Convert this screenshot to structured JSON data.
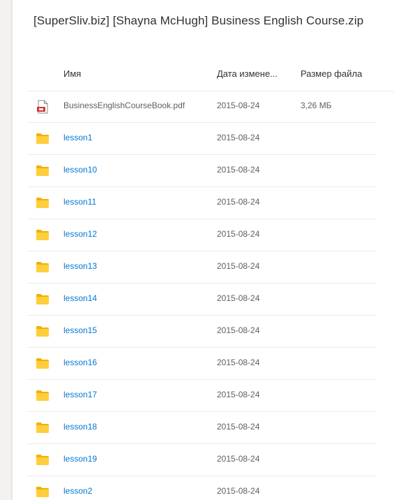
{
  "archive_title": "[SuperSliv.biz] [Shayna McHugh] Business English Course.zip",
  "columns": {
    "name": "Имя",
    "modified": "Дата измене...",
    "size": "Размер файла"
  },
  "items": [
    {
      "type": "pdf",
      "icon": "pdf-file-icon",
      "name": "BusinessEnglishCourseBook.pdf",
      "modified": "2015-08-24",
      "size": "3,26 МБ"
    },
    {
      "type": "folder",
      "icon": "folder-icon",
      "name": "lesson1",
      "modified": "2015-08-24",
      "size": ""
    },
    {
      "type": "folder",
      "icon": "folder-icon",
      "name": "lesson10",
      "modified": "2015-08-24",
      "size": ""
    },
    {
      "type": "folder",
      "icon": "folder-icon",
      "name": "lesson11",
      "modified": "2015-08-24",
      "size": ""
    },
    {
      "type": "folder",
      "icon": "folder-icon",
      "name": "lesson12",
      "modified": "2015-08-24",
      "size": ""
    },
    {
      "type": "folder",
      "icon": "folder-icon",
      "name": "lesson13",
      "modified": "2015-08-24",
      "size": ""
    },
    {
      "type": "folder",
      "icon": "folder-icon",
      "name": "lesson14",
      "modified": "2015-08-24",
      "size": ""
    },
    {
      "type": "folder",
      "icon": "folder-icon",
      "name": "lesson15",
      "modified": "2015-08-24",
      "size": ""
    },
    {
      "type": "folder",
      "icon": "folder-icon",
      "name": "lesson16",
      "modified": "2015-08-24",
      "size": ""
    },
    {
      "type": "folder",
      "icon": "folder-icon",
      "name": "lesson17",
      "modified": "2015-08-24",
      "size": ""
    },
    {
      "type": "folder",
      "icon": "folder-icon",
      "name": "lesson18",
      "modified": "2015-08-24",
      "size": ""
    },
    {
      "type": "folder",
      "icon": "folder-icon",
      "name": "lesson19",
      "modified": "2015-08-24",
      "size": ""
    },
    {
      "type": "folder",
      "icon": "folder-icon",
      "name": "lesson2",
      "modified": "2015-08-24",
      "size": ""
    }
  ],
  "colors": {
    "folder": "#ffce3d",
    "folder_tab": "#f2b000",
    "link": "#0078d4",
    "pdf_accent": "#d13438"
  }
}
